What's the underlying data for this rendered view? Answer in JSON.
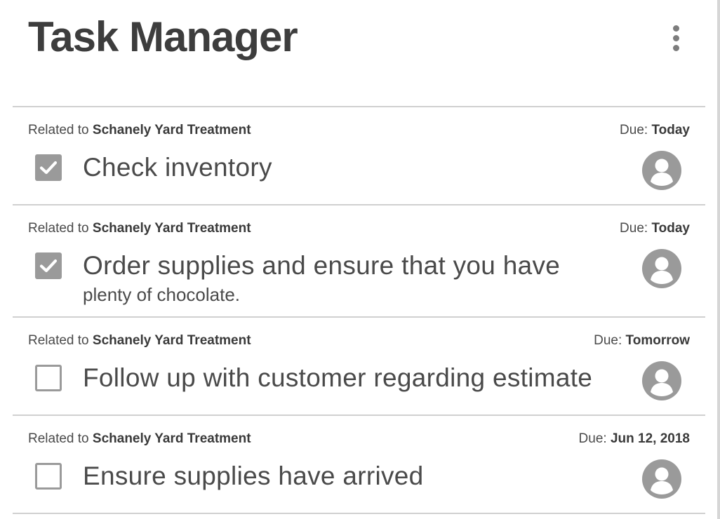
{
  "header": {
    "title": "Task Manager",
    "menu_icon": "more-vertical-icon"
  },
  "tasks": [
    {
      "related_prefix": "Related to",
      "related_project": "Schanely Yard Treatment",
      "due_prefix": "Due:",
      "due_value": "Today",
      "title": "Check inventory",
      "subtitle": "",
      "completed": true,
      "assignee_icon": "user-avatar-icon"
    },
    {
      "related_prefix": "Related to",
      "related_project": "Schanely Yard Treatment",
      "due_prefix": "Due:",
      "due_value": "Today",
      "title": "Order supplies and ensure that you have",
      "subtitle": "plenty of chocolate.",
      "completed": true,
      "assignee_icon": "user-avatar-icon"
    },
    {
      "related_prefix": "Related to",
      "related_project": "Schanely Yard Treatment",
      "due_prefix": "Due:",
      "due_value": "Tomorrow",
      "title": "Follow up with customer regarding estimate",
      "subtitle": "",
      "completed": false,
      "assignee_icon": "user-avatar-icon"
    },
    {
      "related_prefix": "Related to",
      "related_project": "Schanely Yard Treatment",
      "due_prefix": "Due:",
      "due_value": "Jun 12, 2018",
      "title": "Ensure supplies have arrived",
      "subtitle": "",
      "completed": false,
      "assignee_icon": "user-avatar-icon"
    }
  ],
  "colors": {
    "text": "#3d3d3d",
    "checkbox": "#9a9a9a",
    "avatar": "#9a9a9a",
    "divider": "#d0d0d0"
  }
}
